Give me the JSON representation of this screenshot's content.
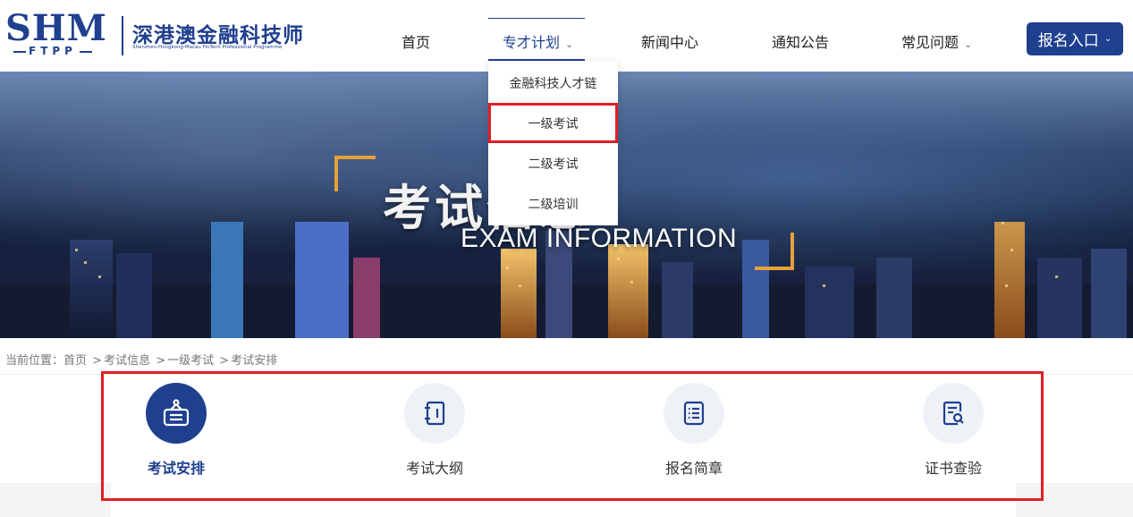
{
  "header": {
    "logo_mark": "SHM",
    "logo_sub": "FTPP",
    "logo_cn": "深港澳金融科技师",
    "logo_en": "Shenzhen-Hongkong-Macau FinTech Professional Programme",
    "nav": [
      {
        "label": "首页"
      },
      {
        "label": "专才计划",
        "chevron": "⌄"
      },
      {
        "label": "新闻中心"
      },
      {
        "label": "通知公告"
      },
      {
        "label": "常见问题",
        "chevron": "⌄"
      }
    ],
    "apply_label": "报名入口",
    "apply_chevron": "⌄"
  },
  "banner": {
    "title_cn": "考试信息",
    "title_en": "EXAM INFORMATION"
  },
  "dropdown": {
    "items": [
      {
        "label": "金融科技人才链"
      },
      {
        "label": "一级考试"
      },
      {
        "label": "二级考试"
      },
      {
        "label": "二级培训"
      }
    ]
  },
  "breadcrumb": {
    "prefix": "当前位置：",
    "items": [
      "首页",
      "考试信息",
      "一级考试",
      "考试安排"
    ],
    "separator": ">"
  },
  "tabs": [
    {
      "label": "考试安排",
      "icon": "exam-schedule-icon"
    },
    {
      "label": "考试大纲",
      "icon": "notebook-icon"
    },
    {
      "label": "报名简章",
      "icon": "list-document-icon"
    },
    {
      "label": "证书查验",
      "icon": "certificate-search-icon"
    }
  ],
  "colors": {
    "brand": "#1f3f8f",
    "highlight": "#e01e26",
    "accent_gold": "#e5a23a"
  }
}
